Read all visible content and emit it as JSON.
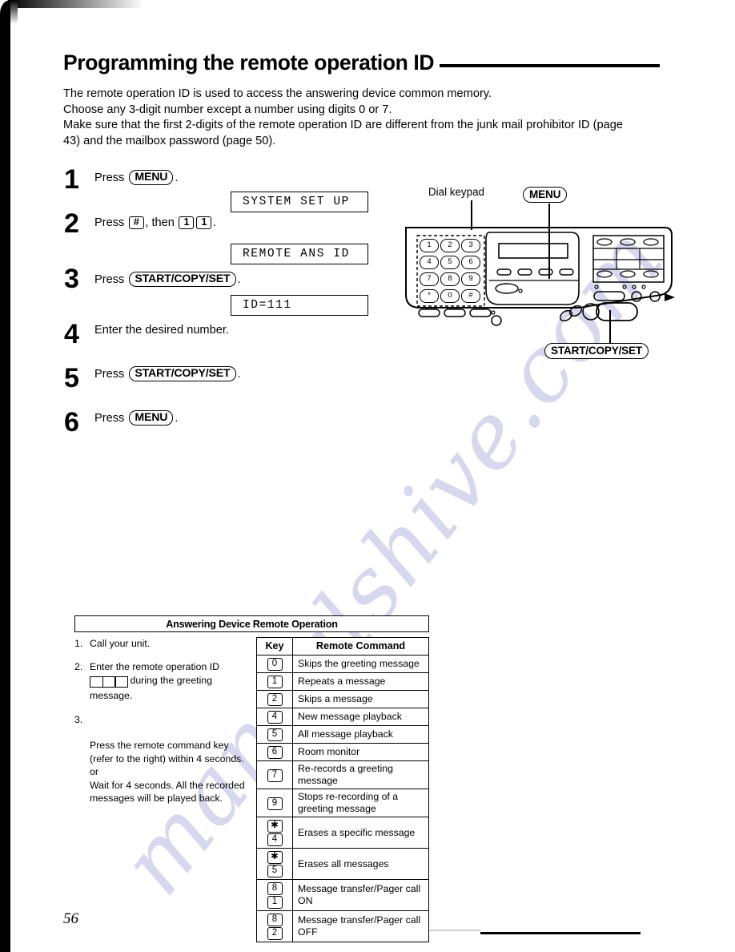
{
  "page": {
    "title": "Programming the remote operation ID",
    "number": "56",
    "watermark": "manualshive.com"
  },
  "intro": {
    "line1": "The remote operation ID is used to access the answering device common memory.",
    "line2": "Choose any 3-digit number except a number using digits 0 or 7.",
    "line3": "Make sure that the first 2-digits of the remote operation ID are different from the junk mail prohibitor ID (page",
    "line4": "43) and the mailbox password (page 50)."
  },
  "steps": [
    {
      "num": "1",
      "prefix": "Press",
      "key": "MENU",
      "suffix": "."
    },
    {
      "num": "2",
      "prefix": "Press",
      "key1": "#",
      "mid": ", then",
      "key2": "1",
      "key3": "1",
      "suffix": "."
    },
    {
      "num": "3",
      "prefix": "Press",
      "key": "START/COPY/SET",
      "suffix": "."
    },
    {
      "num": "4",
      "text": "Enter the desired number."
    },
    {
      "num": "5",
      "prefix": "Press",
      "key": "START/COPY/SET",
      "suffix": "."
    },
    {
      "num": "6",
      "prefix": "Press",
      "key": "MENU",
      "suffix": "."
    }
  ],
  "displays": [
    {
      "text": "SYSTEM SET UP"
    },
    {
      "text": "REMOTE ANS ID"
    },
    {
      "text": "ID=111"
    }
  ],
  "device": {
    "callout_keypad": "Dial keypad",
    "callout_menu": "MENU",
    "callout_start": "START/COPY/SET",
    "keypad_keys": [
      "1",
      "2",
      "3",
      "4",
      "5",
      "6",
      "7",
      "8",
      "9",
      "*",
      "0",
      "#"
    ]
  },
  "reference": {
    "title": "Answering Device Remote Operation",
    "steps": [
      {
        "num": "1.",
        "text": "Call your unit."
      },
      {
        "num": "2.",
        "pre": "Enter the remote operation ID",
        "post": "during the greeting message."
      },
      {
        "num": "3.",
        "text": "Press the remote command key (refer to the right) within 4 seconds.\nor\nWait for 4 seconds. All the recorded messages will be played back."
      }
    ],
    "table": {
      "headers": [
        "Key",
        "Remote Command"
      ],
      "rows": [
        {
          "keys": [
            "0"
          ],
          "command": "Skips the greeting message"
        },
        {
          "keys": [
            "1"
          ],
          "command": "Repeats a message"
        },
        {
          "keys": [
            "2"
          ],
          "command": "Skips a message"
        },
        {
          "keys": [
            "4"
          ],
          "command": "New message playback"
        },
        {
          "keys": [
            "5"
          ],
          "command": "All message playback"
        },
        {
          "keys": [
            "6"
          ],
          "command": "Room monitor"
        },
        {
          "keys": [
            "7"
          ],
          "command": "Re-records a greeting message"
        },
        {
          "keys": [
            "9"
          ],
          "command": "Stops re-recording of a greeting message"
        },
        {
          "keys": [
            "✱",
            "4"
          ],
          "command": "Erases a specific message"
        },
        {
          "keys": [
            "✱",
            "5"
          ],
          "command": "Erases all messages"
        },
        {
          "keys": [
            "8",
            "1"
          ],
          "command": "Message transfer/Pager call ON"
        },
        {
          "keys": [
            "8",
            "2"
          ],
          "command": "Message transfer/Pager call OFF"
        }
      ]
    }
  }
}
